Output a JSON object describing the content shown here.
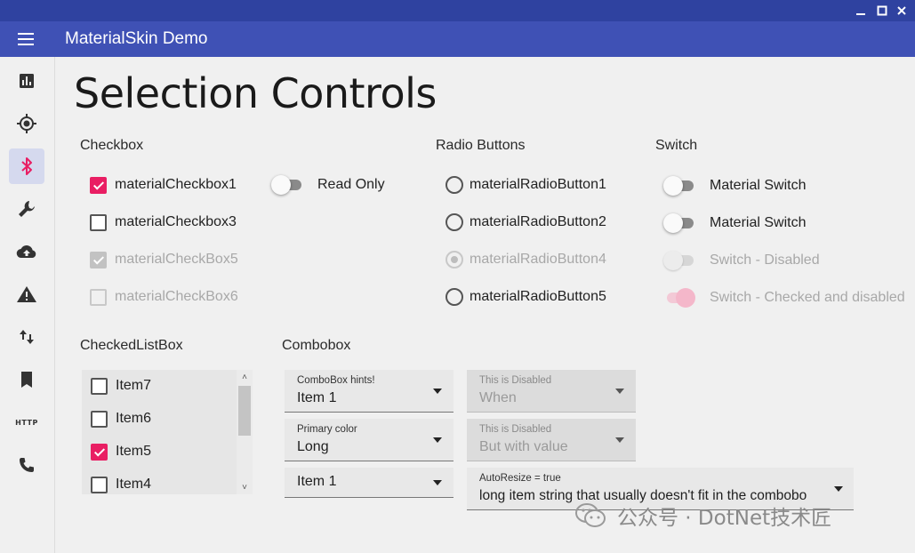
{
  "window": {
    "title": "MaterialSkin Demo",
    "controls": [
      "minimize-icon",
      "maximize-icon",
      "close-icon"
    ]
  },
  "colors": {
    "titlebar": "#2f42a0",
    "appbar": "#3f51b5",
    "accent": "#e91e63",
    "drawer_active": "#d5d9ee",
    "background": "#f0f0f0"
  },
  "drawer": {
    "items": [
      {
        "icon": "bar-chart-icon",
        "active": false
      },
      {
        "icon": "gps-target-icon",
        "active": false
      },
      {
        "icon": "bluetooth-icon",
        "active": true
      },
      {
        "icon": "wrench-icon",
        "active": false
      },
      {
        "icon": "cloud-upload-icon",
        "active": false
      },
      {
        "icon": "warning-icon",
        "active": false
      },
      {
        "icon": "swap-vertical-icon",
        "active": false
      },
      {
        "icon": "bookmark-icon",
        "active": false
      },
      {
        "icon": "http-icon",
        "label": "HTTP",
        "active": false
      },
      {
        "icon": "phone-icon",
        "active": false
      }
    ]
  },
  "page": {
    "title": "Selection Controls"
  },
  "checkbox": {
    "section_title": "Checkbox",
    "items": [
      {
        "label": "materialCheckbox1",
        "checked": true,
        "disabled": false
      },
      {
        "label": "materialCheckbox3",
        "checked": false,
        "disabled": false
      },
      {
        "label": "materialCheckBox5",
        "checked": true,
        "disabled": true
      },
      {
        "label": "materialCheckBox6",
        "checked": false,
        "disabled": true
      }
    ],
    "readonly_switch": {
      "label": "Read Only",
      "on": false
    }
  },
  "radio": {
    "section_title": "Radio Buttons",
    "items": [
      {
        "label": "materialRadioButton1",
        "selected": false,
        "disabled": false
      },
      {
        "label": "materialRadioButton2",
        "selected": false,
        "disabled": false
      },
      {
        "label": "materialRadioButton4",
        "selected": true,
        "disabled": true
      },
      {
        "label": "materialRadioButton5",
        "selected": false,
        "disabled": false
      }
    ]
  },
  "switch": {
    "section_title": "Switch",
    "items": [
      {
        "label": "Material Switch",
        "on": false,
        "disabled": false
      },
      {
        "label": "Material Switch",
        "on": false,
        "disabled": false
      },
      {
        "label": "Switch - Disabled",
        "on": false,
        "disabled": true
      },
      {
        "label": "Switch - Checked and disabled",
        "on": true,
        "disabled": true
      }
    ]
  },
  "checkedlistbox": {
    "section_title": "CheckedListBox",
    "items": [
      {
        "label": "Item7",
        "checked": false
      },
      {
        "label": "Item6",
        "checked": false
      },
      {
        "label": "Item5",
        "checked": true
      },
      {
        "label": "Item4",
        "checked": false
      }
    ],
    "scroll_up": "˄",
    "scroll_down": "˅"
  },
  "combobox": {
    "section_title": "Combobox",
    "boxes": [
      {
        "hint": "ComboBox hints!",
        "value": "Item 1",
        "disabled": false
      },
      {
        "hint": "This is Disabled",
        "value": "When",
        "disabled": true
      },
      {
        "hint": "Primary color",
        "value": "Long",
        "disabled": false
      },
      {
        "hint": "This is Disabled",
        "value": "But with value",
        "disabled": true
      },
      {
        "hint": "",
        "value": "Item 1",
        "disabled": false
      },
      {
        "hint": "AutoResize = true",
        "value": "long item string that usually doesn't fit in the combobo",
        "disabled": false
      }
    ]
  },
  "watermark": {
    "text": "公众号 · DotNet技术匠",
    "icon": "wechat-icon"
  }
}
